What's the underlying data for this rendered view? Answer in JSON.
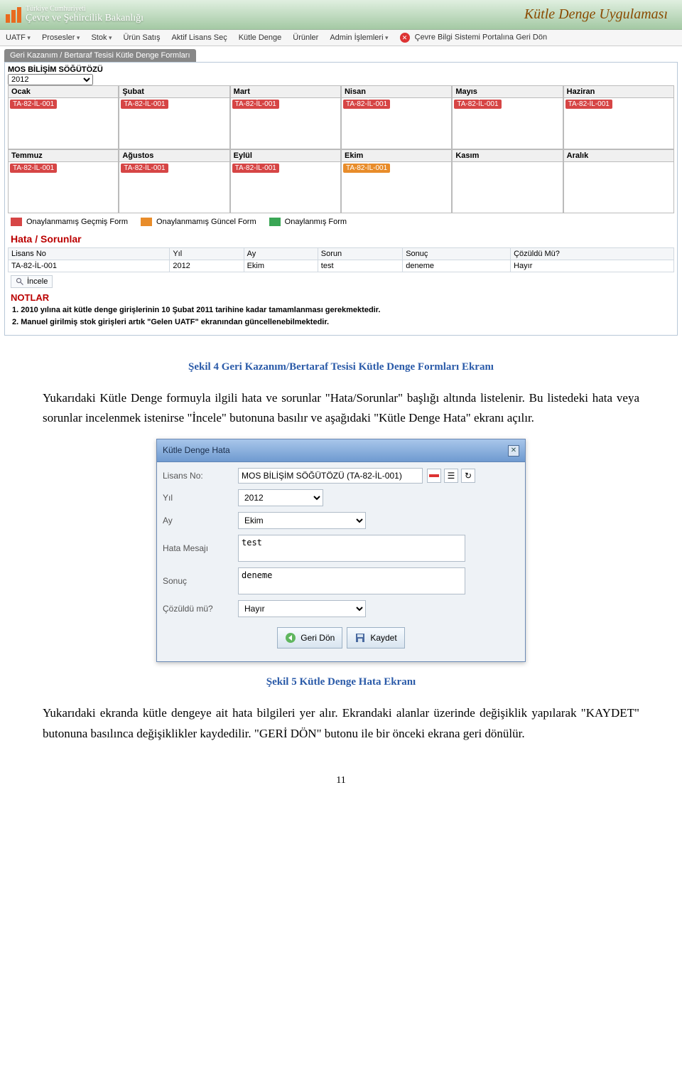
{
  "header": {
    "small": "Türkiye Cumhuriyeti",
    "title": "Çevre ve Şehircilik Bakanlığı",
    "app": "Kütle Denge Uygulaması"
  },
  "menu": {
    "items": [
      "UATF",
      "Prosesler",
      "Stok",
      "Ürün Satış",
      "Aktif Lisans Seç",
      "Kütle Denge",
      "Ürünler",
      "Admin İşlemleri"
    ],
    "portal": "Çevre Bilgi Sistemi Portalına Geri Dön"
  },
  "crumb": "Geri Kazanım / Bertaraf Tesisi Kütle Denge Formları",
  "company": "MOS BİLİŞİM SÖĞÜTÖZÜ",
  "year": "2012",
  "months": [
    {
      "name": "Ocak",
      "lic": "TA-82-İL-001",
      "color": "red"
    },
    {
      "name": "Şubat",
      "lic": "TA-82-İL-001",
      "color": "red"
    },
    {
      "name": "Mart",
      "lic": "TA-82-İL-001",
      "color": "red"
    },
    {
      "name": "Nisan",
      "lic": "TA-82-İL-001",
      "color": "red"
    },
    {
      "name": "Mayıs",
      "lic": "TA-82-İL-001",
      "color": "red"
    },
    {
      "name": "Haziran",
      "lic": "TA-82-İL-001",
      "color": "red"
    },
    {
      "name": "Temmuz",
      "lic": "TA-82-İL-001",
      "color": "red"
    },
    {
      "name": "Ağustos",
      "lic": "TA-82-İL-001",
      "color": "red"
    },
    {
      "name": "Eylül",
      "lic": "TA-82-İL-001",
      "color": "red"
    },
    {
      "name": "Ekim",
      "lic": "TA-82-İL-001",
      "color": "orange"
    },
    {
      "name": "Kasım",
      "lic": "",
      "color": ""
    },
    {
      "name": "Aralık",
      "lic": "",
      "color": ""
    }
  ],
  "legend": {
    "a": "Onaylanmamış Geçmiş Form",
    "b": "Onaylanmamış Güncel Form",
    "c": "Onaylanmış Form"
  },
  "hstitle": "Hata / Sorunlar",
  "htable": {
    "headers": [
      "Lisans No",
      "Yıl",
      "Ay",
      "Sorun",
      "Sonuç",
      "Çözüldü Mü?"
    ],
    "row": [
      "TA-82-İL-001",
      "2012",
      "Ekim",
      "test",
      "deneme",
      "Hayır"
    ]
  },
  "incele": "İncele",
  "notes": {
    "title": "NOTLAR",
    "n1": "1. 2010 yılına ait kütle denge girişlerinin 10 Şubat 2011 tarihine kadar tamamlanması gerekmektedir.",
    "n2": "2. Manuel girilmiş stok girişleri artık \"Gelen UATF\" ekranından güncellenebilmektedir."
  },
  "caption1": "Şekil 4 Geri Kazanım/Bertaraf Tesisi Kütle Denge Formları Ekranı",
  "para1": "Yukarıdaki Kütle Denge formuyla ilgili hata ve sorunlar \"Hata/Sorunlar\" başlığı altında listelenir. Bu listedeki hata veya sorunlar incelenmek istenirse \"İncele\" butonuna basılır ve aşağıdaki \"Kütle Denge Hata\" ekranı açılır.",
  "dialog": {
    "title": "Kütle Denge Hata",
    "labels": {
      "lisans": "Lisans No:",
      "yil": "Yıl",
      "ay": "Ay",
      "hata": "Hata Mesajı",
      "sonuc": "Sonuç",
      "coz": "Çözüldü mü?"
    },
    "values": {
      "lisans": "MOS BİLİŞİM SÖĞÜTÖZÜ (TA-82-İL-001)",
      "yil": "2012",
      "ay": "Ekim",
      "hata": "test",
      "sonuc": "deneme",
      "coz": "Hayır"
    },
    "buttons": {
      "back": "Geri Dön",
      "save": "Kaydet"
    }
  },
  "caption2": "Şekil 5 Kütle Denge Hata Ekranı",
  "para2": "Yukarıdaki ekranda kütle dengeye ait hata bilgileri yer alır. Ekrandaki alanlar üzerinde değişiklik yapılarak \"KAYDET\" butonuna basılınca değişiklikler kaydedilir. \"GERİ DÖN\" butonu ile bir önceki ekrana geri dönülür.",
  "page": "11"
}
